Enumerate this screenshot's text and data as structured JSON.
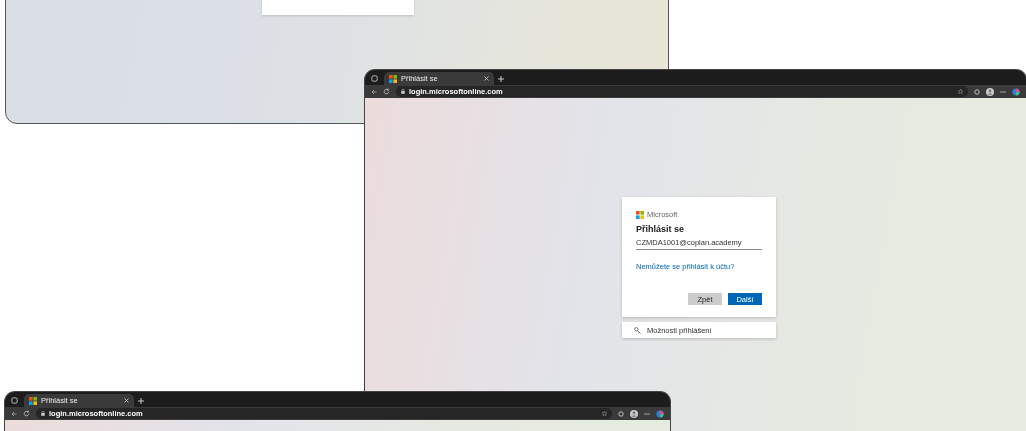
{
  "windows": [
    {
      "kind": "browser",
      "tab_title": "Přihlásit se",
      "url_host": "login.microsoftonline.com",
      "signin": {
        "brand": "Microsoft",
        "title": "Přihlásit se",
        "email": "CZMDA1001@coplan.academy",
        "link": "Nemůžete se přihlásit k účtu?",
        "buttons": [
          {
            "label": "Zpět",
            "kind": "secondary"
          },
          {
            "label": "Další",
            "kind": "primary"
          }
        ],
        "options": "Možnosti přihlášení"
      }
    },
    {
      "kind": "browser",
      "tab_title": "Přihlásit se",
      "url_host": "login.microsoftonline.com"
    }
  ]
}
